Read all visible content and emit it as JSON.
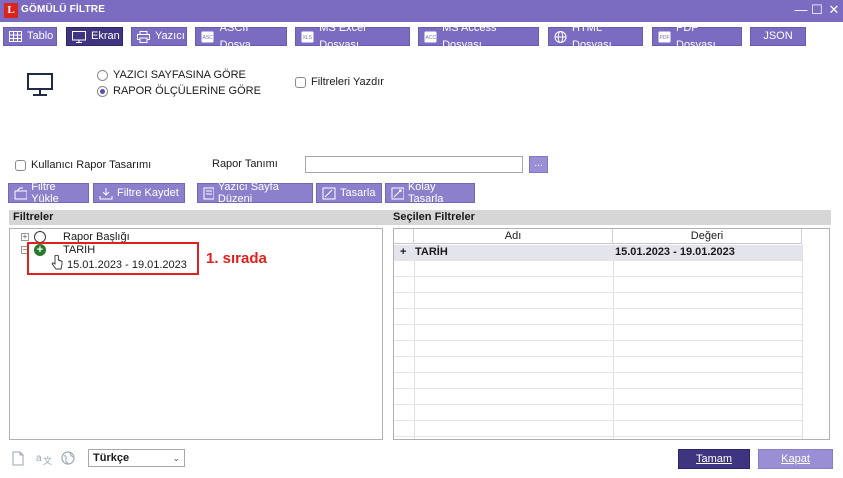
{
  "window": {
    "title": "GÖMÜLÜ FİLTRE",
    "logo": "L"
  },
  "tabs": [
    {
      "label": "Tablo",
      "icon": "table-icon"
    },
    {
      "label": "Ekran",
      "icon": "monitor-icon",
      "active": true
    },
    {
      "label": "Yazıcı",
      "icon": "printer-icon"
    },
    {
      "label": "ASCII Dosya",
      "icon": "ascii-file-icon"
    },
    {
      "label": "MS Excel Dosyası",
      "icon": "excel-file-icon"
    },
    {
      "label": "MS Access Dosyası",
      "icon": "access-file-icon"
    },
    {
      "label": "HTML Dosyası",
      "icon": "globe-icon"
    },
    {
      "label": "PDF Dosyası",
      "icon": "pdf-file-icon"
    },
    {
      "label": "JSON",
      "icon": ""
    }
  ],
  "options": {
    "radio1": "YAZICI SAYFASINA GÖRE",
    "radio2": "RAPOR ÖLÇÜLERİNE GÖRE",
    "selected": "radio2",
    "print_filters": "Filtreleri Yazdır",
    "user_design": "Kullanıcı Rapor Tasarımı",
    "report_def_label": "Rapor Tanımı",
    "report_def_value": "",
    "browse": "..."
  },
  "actions": {
    "load_filter": "Filtre Yükle",
    "save_filter": "Filtre Kaydet",
    "page_layout": "Yazıcı Sayfa Düzeni",
    "design": "Tasarla",
    "easy_design": "Kolay Tasarla"
  },
  "filters": {
    "heading": "Filtreler",
    "items": [
      {
        "label": "Rapor Başlığı",
        "value": ""
      },
      {
        "label": "TARİH",
        "value": "15.01.2023 - 19.01.2023"
      }
    ]
  },
  "annotation": "1. sırada",
  "selected_filters": {
    "heading": "Seçilen Filtreler",
    "columns": [
      "Adı",
      "Değeri"
    ],
    "rows": [
      {
        "marker": "+",
        "name": "TARİH",
        "value": "15.01.2023 - 19.01.2023"
      }
    ]
  },
  "footer": {
    "language": "Türkçe",
    "ok": "Tamam",
    "close": "Kapat"
  },
  "colors": {
    "accent": "#7b6cc2",
    "active_tab": "#3f3480",
    "annotation": "#e0201c"
  }
}
